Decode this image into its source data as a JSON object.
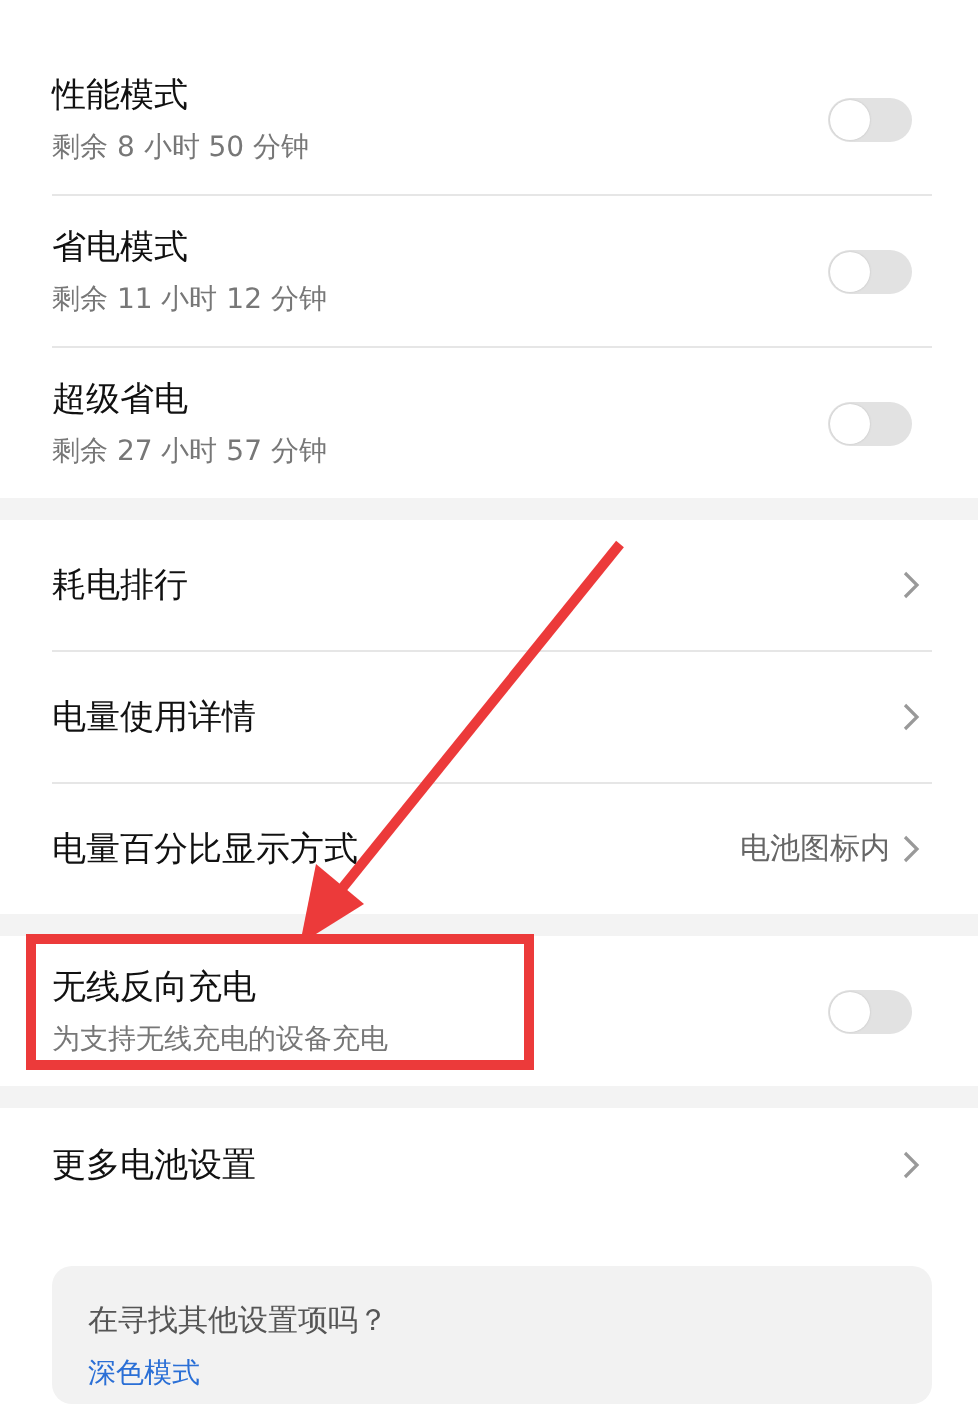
{
  "groups": [
    {
      "items": [
        {
          "kind": "toggle",
          "title": "性能模式",
          "subtitle": "剩余 8 小时 50 分钟",
          "on": false
        },
        {
          "kind": "toggle",
          "title": "省电模式",
          "subtitle": "剩余 11 小时 12 分钟",
          "on": false
        },
        {
          "kind": "toggle",
          "title": "超级省电",
          "subtitle": "剩余 27 小时 57 分钟",
          "on": false
        }
      ]
    },
    {
      "items": [
        {
          "kind": "link",
          "title": "耗电排行"
        },
        {
          "kind": "link",
          "title": "电量使用详情"
        },
        {
          "kind": "link",
          "title": "电量百分比显示方式",
          "value": "电池图标内"
        }
      ]
    },
    {
      "items": [
        {
          "kind": "toggle",
          "title": "无线反向充电",
          "subtitle": "为支持无线充电的设备充电",
          "on": false
        }
      ]
    },
    {
      "items": [
        {
          "kind": "link",
          "title": "更多电池设置"
        }
      ]
    }
  ],
  "suggestion": {
    "question": "在寻找其他设置项吗？",
    "link": "深色模式"
  }
}
